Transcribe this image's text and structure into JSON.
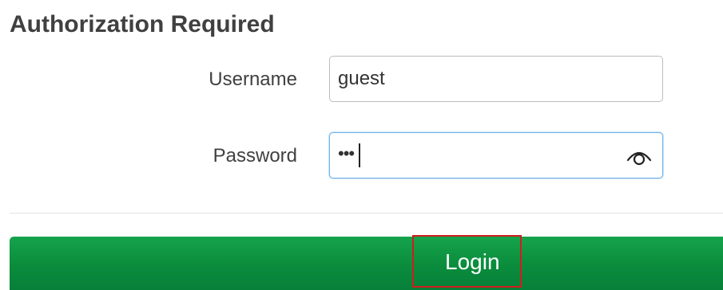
{
  "header": {
    "title": "Authorization Required"
  },
  "form": {
    "username": {
      "label": "Username",
      "value": "guest"
    },
    "password": {
      "label": "Password",
      "masked_value": "•••"
    },
    "login_label": "Login"
  },
  "icons": {
    "password_toggle": "eye-icon"
  },
  "colors": {
    "button_green": "#0a8c3c",
    "focus_border": "#6fb3e8",
    "highlight_red": "#d11d1d"
  }
}
